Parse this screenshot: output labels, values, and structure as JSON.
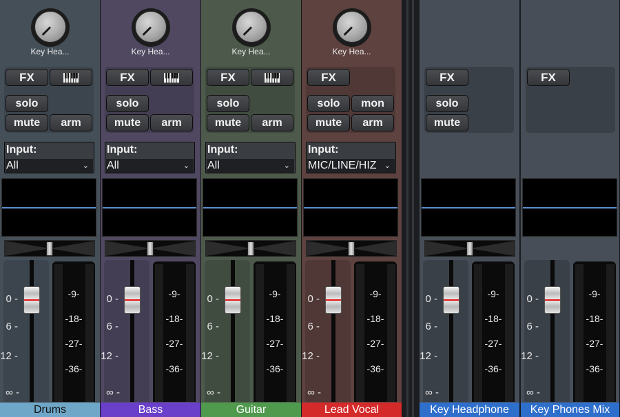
{
  "tracks": [
    {
      "id": "drums",
      "name": "Drums",
      "knob_label": "Key Hea...",
      "input_label": "Input:",
      "input_value": "All",
      "strip_color": "#454f58",
      "panel_color": "#3c454d",
      "name_bg": "#6fa7c8",
      "name_fg": "#111111",
      "has_piano": true,
      "has_mon": false,
      "has_arm": true
    },
    {
      "id": "bass",
      "name": "Bass",
      "knob_label": "Key Hea...",
      "input_label": "Input:",
      "input_value": "All",
      "strip_color": "#4f4860",
      "panel_color": "#443e54",
      "name_bg": "#6a3fc9",
      "name_fg": "#ffffff",
      "has_piano": true,
      "has_mon": false,
      "has_arm": true
    },
    {
      "id": "guitar",
      "name": "Guitar",
      "knob_label": "Key Hea...",
      "input_label": "Input:",
      "input_value": "All",
      "strip_color": "#4d5a4b",
      "panel_color": "#404c3f",
      "name_bg": "#4f9a4c",
      "name_fg": "#ffffff",
      "has_piano": true,
      "has_mon": false,
      "has_arm": true
    },
    {
      "id": "lead-vocal",
      "name": "Lead Vocal",
      "knob_label": "Key Hea...",
      "input_label": "Input:",
      "input_value": "MIC/LINE/HIZ",
      "strip_color": "#5e423f",
      "panel_color": "#4f3836",
      "name_bg": "#d52a2a",
      "name_fg": "#ffffff",
      "has_piano": false,
      "has_mon": true,
      "has_arm": true
    }
  ],
  "buses": [
    {
      "id": "key-headphone",
      "name": "Key Headphone",
      "strip_color": "#474e57",
      "panel_color": "#3a4048",
      "name_bg": "#2f6fcc",
      "name_fg": "#ffffff",
      "has_solo": true,
      "has_mute": true,
      "has_pan": true
    },
    {
      "id": "key-phones-mix",
      "name": "Key Phones Mix",
      "strip_color": "#474e57",
      "panel_color": "#3a4048",
      "name_bg": "#2f6fcc",
      "name_fg": "#ffffff",
      "has_solo": false,
      "has_mute": false,
      "has_pan": false
    }
  ],
  "buttons": {
    "fx": "FX",
    "solo": "solo",
    "mute": "mute",
    "arm": "arm",
    "mon": "mon"
  },
  "fader_scale": [
    "0",
    "6",
    "12",
    "∞"
  ],
  "meter_scale": [
    "9",
    "18",
    "27",
    "36"
  ],
  "icons": {
    "piano": "piano-icon",
    "knob": "knob-icon",
    "dropdown": "chevron-down-icon"
  }
}
